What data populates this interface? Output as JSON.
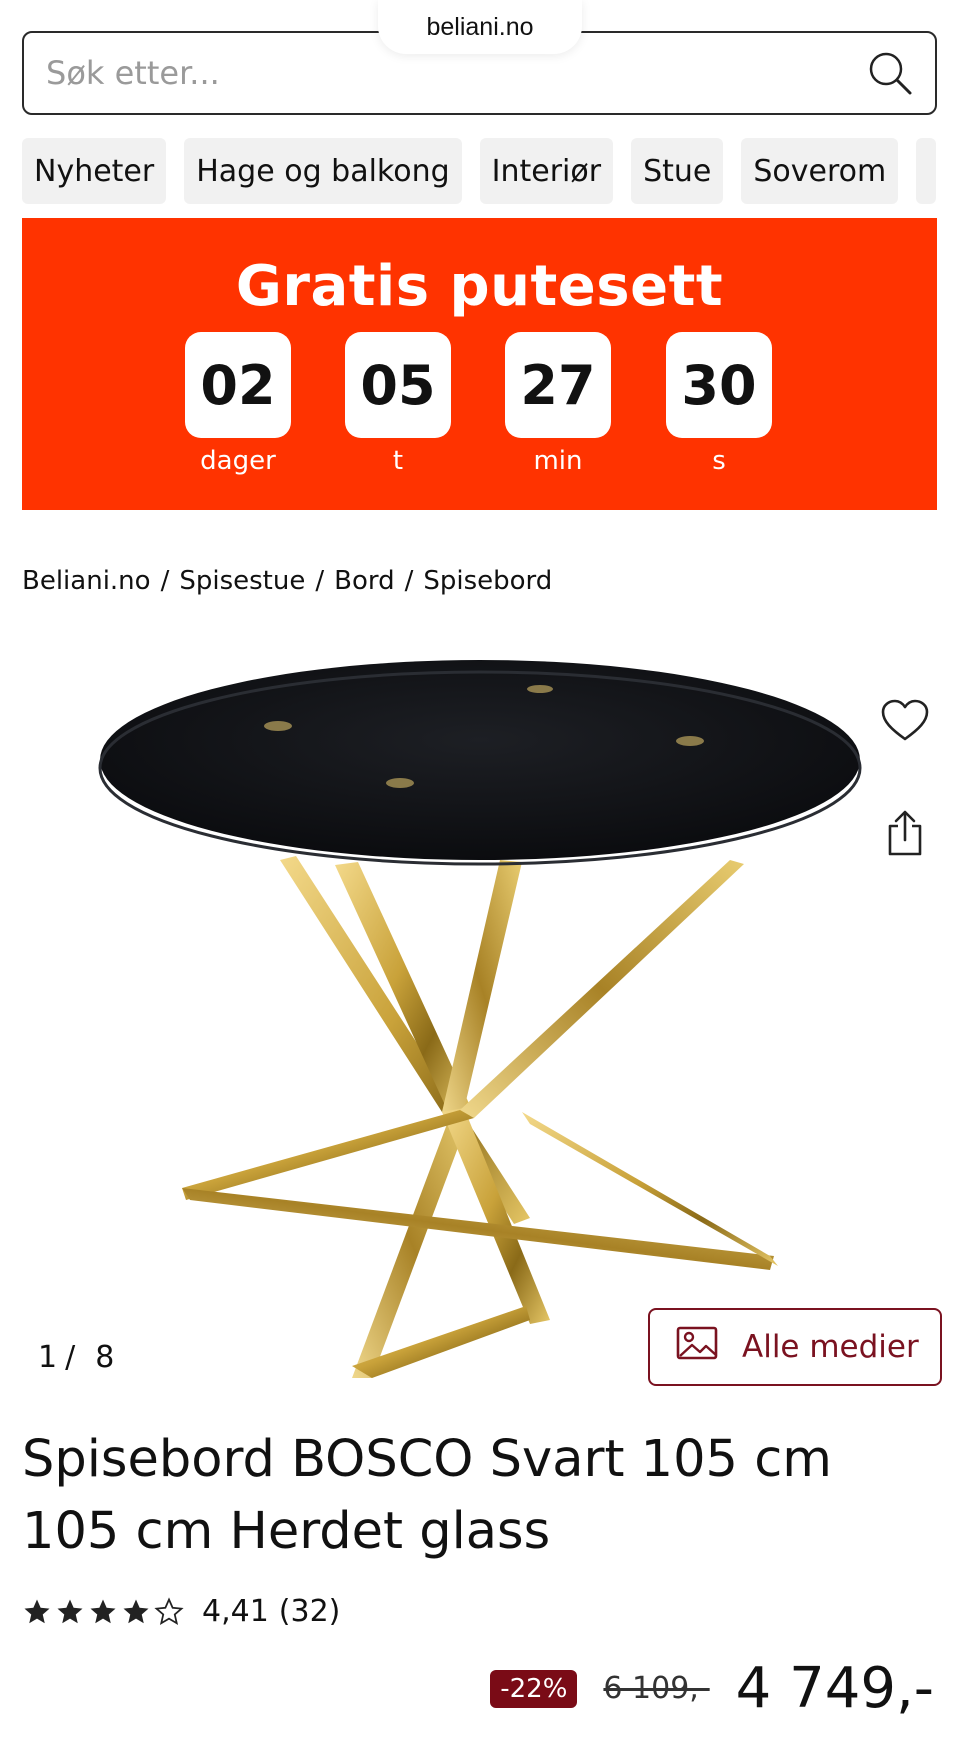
{
  "browser": {
    "url": "beliani.no"
  },
  "search": {
    "placeholder": "Søk etter...",
    "value": ""
  },
  "nav": {
    "items": [
      {
        "label": "Nyheter"
      },
      {
        "label": "Hage og balkong"
      },
      {
        "label": "Interiør"
      },
      {
        "label": "Stue"
      },
      {
        "label": "Soverom"
      }
    ]
  },
  "promo": {
    "title": "Gratis putesett",
    "background": "#ff3300",
    "countdown": [
      {
        "value": "02",
        "unit": "dager"
      },
      {
        "value": "05",
        "unit": "t"
      },
      {
        "value": "27",
        "unit": "min"
      },
      {
        "value": "30",
        "unit": "s"
      }
    ]
  },
  "breadcrumb": [
    "Beliani.no",
    "Spisestue",
    "Bord",
    "Spisebord"
  ],
  "gallery": {
    "current": "1",
    "separator": "/",
    "total": "8",
    "all_media_label": "Alle medier"
  },
  "product": {
    "title": "Spisebord BOSCO Svart 105 cm 105 cm Herdet glass",
    "rating_value": "4,41",
    "rating_count": "(32)",
    "stars_filled": 4,
    "stars_total": 5,
    "discount_badge": "-22%",
    "old_price": "6 109,-",
    "price": "4 749,-"
  },
  "colors": {
    "accent": "#7a1220",
    "promo": "#ff3300",
    "discount_bg": "#7a0b16"
  }
}
